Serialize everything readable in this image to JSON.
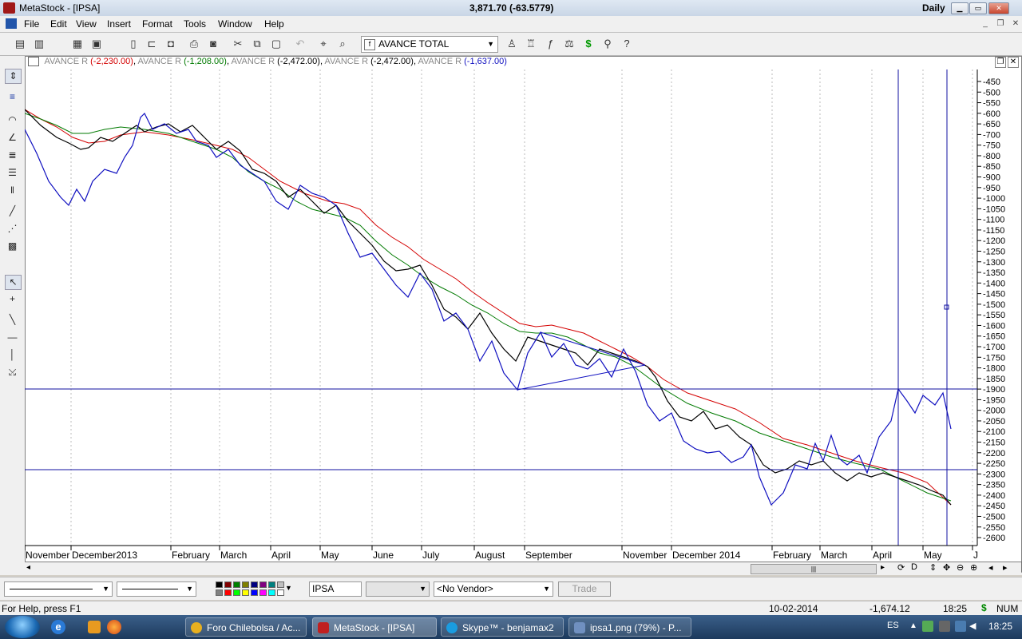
{
  "window": {
    "title": "MetaStock - [IPSA]",
    "quote": "3,871.70 (-63.5779)",
    "period": "Daily",
    "min_label": "▁",
    "max_label": "▭",
    "close_label": "✕"
  },
  "menu": [
    "File",
    "Edit",
    "View",
    "Insert",
    "Format",
    "Tools",
    "Window",
    "Help"
  ],
  "toolbar": {
    "security_combo": "AVANCE TOTAL"
  },
  "chart": {
    "header": [
      {
        "name": "AVANCE R",
        "value": "(-2,230.00)",
        "color": "#d40000"
      },
      {
        "name": "AVANCE R",
        "value": "(-1,208.00)",
        "color": "#007a00"
      },
      {
        "name": "AVANCE R",
        "value": "(-2,472.00)",
        "color": "#000000"
      },
      {
        "name": "AVANCE R",
        "value": "(-2,472.00)",
        "color": "#000000"
      },
      {
        "name": "AVANCE R",
        "value": "(-1,637.00)",
        "color": "#1010c0"
      }
    ],
    "y_ticks": [
      "-450",
      "-500",
      "-550",
      "-600",
      "-650",
      "-700",
      "-750",
      "-800",
      "-850",
      "-900",
      "-950",
      "-1000",
      "-1050",
      "-1100",
      "-1150",
      "-1200",
      "-1250",
      "-1300",
      "-1350",
      "-1400",
      "-1450",
      "-1500",
      "-1550",
      "-1600",
      "-1650",
      "-1700",
      "-1750",
      "-1800",
      "-1850",
      "-1900",
      "-1950",
      "-2000",
      "-2050",
      "-2100",
      "-2150",
      "-2200",
      "-2250",
      "-2300",
      "-2350",
      "-2400",
      "-2450",
      "-2500",
      "-2550",
      "-2600"
    ],
    "x_ticks": [
      "November",
      "December2013",
      "February",
      "March",
      "April",
      "May",
      "June",
      "July",
      "August",
      "September",
      "November",
      "December 2014",
      "February",
      "March",
      "April",
      "May",
      "J"
    ]
  },
  "stylebar": {
    "symbol_input": "IPSA",
    "vendor": "<No Vendor>",
    "trade_button": "Trade"
  },
  "status": {
    "help": "For Help, press F1",
    "date": "10-02-2014",
    "value": "-1,674.12",
    "time": "18:25",
    "dollar": "$",
    "num": "NUM"
  },
  "taskbar": {
    "tasks": [
      {
        "label": "Foro Chilebolsa / Ac...",
        "color": "#e8b020"
      },
      {
        "label": "MetaStock - [IPSA]",
        "color": "#c02020"
      },
      {
        "label": "Skype™ - benjamax2",
        "color": "#1a9ce0"
      },
      {
        "label": "ipsa1.png (79%) - P...",
        "color": "#7090c0"
      }
    ],
    "lang": "ES",
    "clock": "18:25"
  }
}
